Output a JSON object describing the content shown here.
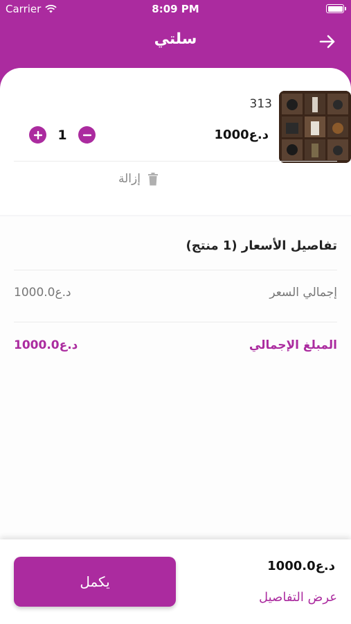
{
  "status_bar": {
    "carrier": "Carrier",
    "time": "8:09 PM"
  },
  "header": {
    "title": "سلتي",
    "back_icon": "arrow-right-icon"
  },
  "cart_item": {
    "name": "313",
    "price": "1000د.ع",
    "quantity": "1",
    "remove_label": "إزالة"
  },
  "price_details": {
    "title": "تفاصيل الأسعار (1 منتج)",
    "subtotal_label": "إجمالي السعر",
    "subtotal_value": "1000.0د.ع",
    "total_label": "المبلغ الإجمالي",
    "total_value": "1000.0د.ع"
  },
  "footer": {
    "total": "1000.0د.ع",
    "view_details_label": "عرض التفاصيل",
    "continue_label": "يكمل"
  },
  "colors": {
    "accent": "#ab2b9f",
    "muted_text": "#777777",
    "divider": "#ececec"
  }
}
